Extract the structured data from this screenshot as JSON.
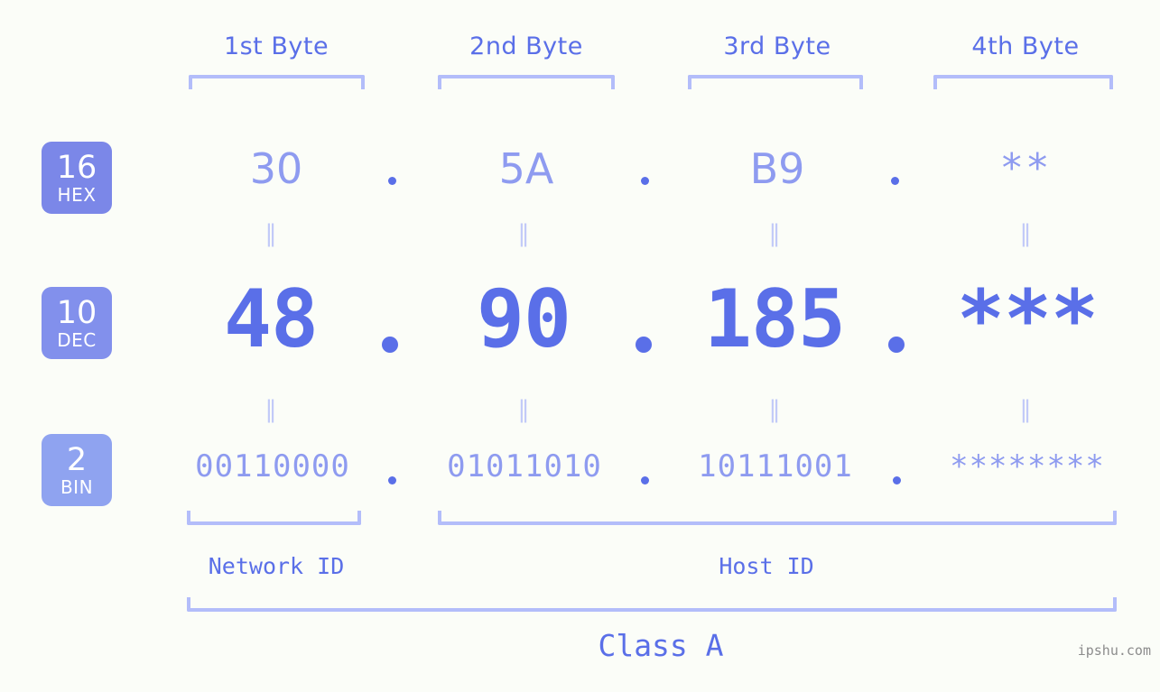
{
  "watermark": "ipshu.com",
  "byte_headers": [
    {
      "label": "1st Byte"
    },
    {
      "label": "2nd Byte"
    },
    {
      "label": "3rd Byte"
    },
    {
      "label": "4th Byte"
    }
  ],
  "bases": [
    {
      "number": "16",
      "name": "HEX",
      "color": "#7b87e8"
    },
    {
      "number": "10",
      "name": "DEC",
      "color": "#8290ec"
    },
    {
      "number": "2",
      "name": "BIN",
      "color": "#8fa3f0"
    }
  ],
  "rows": {
    "hex": {
      "base": "16",
      "name": "HEX",
      "values": [
        "30",
        "5A",
        "B9",
        "**"
      ]
    },
    "dec": {
      "base": "10",
      "name": "DEC",
      "values": [
        "48",
        "90",
        "185",
        "***"
      ]
    },
    "bin": {
      "base": "2",
      "name": "BIN",
      "values": [
        "00110000",
        "01011010",
        "10111001",
        "********"
      ]
    }
  },
  "separators": {
    "dot": ".",
    "equals": "‖"
  },
  "sections": [
    {
      "label": "Network ID"
    },
    {
      "label": "Host ID"
    }
  ],
  "class": {
    "label": "Class A"
  },
  "colors": {
    "background": "#fbfdf8",
    "primary_text": "#5a6fe8",
    "secondary_text": "#8e9bf0",
    "bracket": "#b3bdfa",
    "equals": "#c2caf8",
    "watermark": "#8c8c8c"
  }
}
